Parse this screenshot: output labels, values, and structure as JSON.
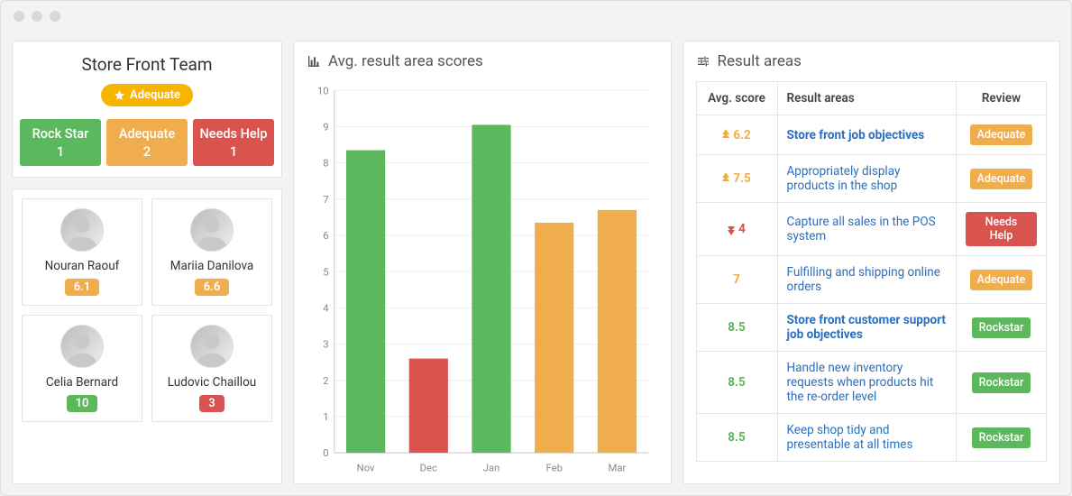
{
  "colors": {
    "green": "#5cb85c",
    "orange": "#f0ad4e",
    "red": "#d9534f"
  },
  "team": {
    "title": "Store Front Team",
    "overall_badge": "Adequate",
    "statuses": [
      {
        "label": "Rock Star",
        "count": "1",
        "color": "green"
      },
      {
        "label": "Adequate",
        "count": "2",
        "color": "orange"
      },
      {
        "label": "Needs Help",
        "count": "1",
        "color": "red"
      }
    ]
  },
  "people": [
    {
      "name": "Nouran Raouf",
      "score": "6.1",
      "color": "orange"
    },
    {
      "name": "Mariia Danilova",
      "score": "6.6",
      "color": "orange"
    },
    {
      "name": "Celia Bernard",
      "score": "10",
      "color": "green"
    },
    {
      "name": "Ludovic Chaillou",
      "score": "3",
      "color": "red"
    }
  ],
  "chart_section_title": "Avg. result area scores",
  "chart_data": {
    "type": "bar",
    "categories": [
      "Nov",
      "Dec",
      "Jan",
      "Feb",
      "Mar"
    ],
    "values": [
      8.35,
      2.6,
      9.05,
      6.35,
      6.7
    ],
    "colors": [
      "green",
      "red",
      "green",
      "orange",
      "orange"
    ],
    "ylim": [
      0,
      10
    ],
    "yticks": [
      0,
      1,
      2,
      3,
      4,
      5,
      6,
      7,
      8,
      9,
      10
    ],
    "title": "Avg. result area scores",
    "xlabel": "",
    "ylabel": ""
  },
  "results_section_title": "Result areas",
  "results_table": {
    "headers": [
      "Avg. score",
      "Result areas",
      "Review"
    ],
    "rows": [
      {
        "score": "6.2",
        "score_color": "orange",
        "trend": "up",
        "area": "Store front job objectives",
        "bold": true,
        "review": "Adequate",
        "review_color": "orange"
      },
      {
        "score": "7.5",
        "score_color": "orange",
        "trend": "up",
        "area": "Appropriately display products in the shop",
        "bold": false,
        "review": "Adequate",
        "review_color": "orange"
      },
      {
        "score": "4",
        "score_color": "red",
        "trend": "down",
        "area": "Capture all sales in the POS system",
        "bold": false,
        "review": "Needs Help",
        "review_color": "red"
      },
      {
        "score": "7",
        "score_color": "orange",
        "trend": "",
        "area": "Fulfilling and shipping online orders",
        "bold": false,
        "review": "Adequate",
        "review_color": "orange"
      },
      {
        "score": "8.5",
        "score_color": "green",
        "trend": "",
        "area": "Store front customer support job objectives",
        "bold": true,
        "review": "Rockstar",
        "review_color": "green"
      },
      {
        "score": "8.5",
        "score_color": "green",
        "trend": "",
        "area": "Handle new inventory requests when products hit the re-order level",
        "bold": false,
        "review": "Rockstar",
        "review_color": "green"
      },
      {
        "score": "8.5",
        "score_color": "green",
        "trend": "",
        "area": "Keep shop tidy and presentable at all times",
        "bold": false,
        "review": "Rockstar",
        "review_color": "green"
      }
    ]
  }
}
